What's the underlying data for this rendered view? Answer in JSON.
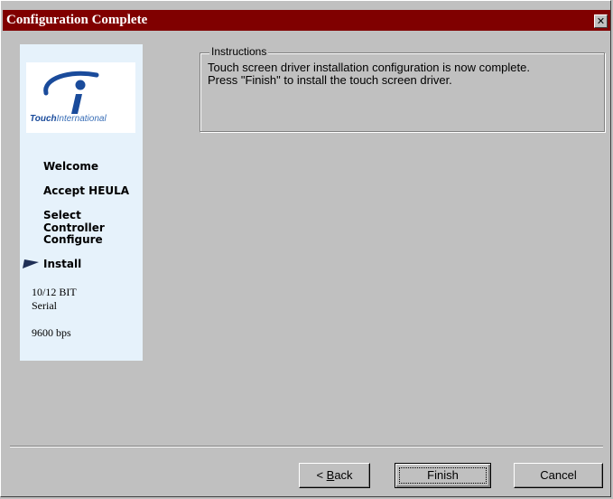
{
  "window": {
    "title": "Configuration Complete",
    "close_glyph": "✕"
  },
  "sidebar": {
    "logo_brand_part1": "Touch",
    "logo_brand_part2": "International",
    "steps": [
      {
        "label": "Welcome"
      },
      {
        "label": "Accept HEULA"
      },
      {
        "label": "Select Controller"
      },
      {
        "label": "Configure"
      },
      {
        "label": "Install",
        "current": true
      }
    ],
    "info": {
      "line1": "10/12 BIT",
      "line2": "Serial",
      "line3": "9600 bps"
    }
  },
  "instructions": {
    "legend": "Instructions",
    "line1": "Touch screen driver installation configuration is now complete.",
    "line2": "Press \"Finish\" to install the touch screen driver."
  },
  "buttons": {
    "back_prefix": "< ",
    "back_hotkey": "B",
    "back_rest": "ack",
    "finish": "Finish",
    "cancel": "Cancel"
  },
  "colors": {
    "titlebar": "#800000",
    "sidebar": "#e6f2fb",
    "logo_blue": "#1a4b9b"
  }
}
